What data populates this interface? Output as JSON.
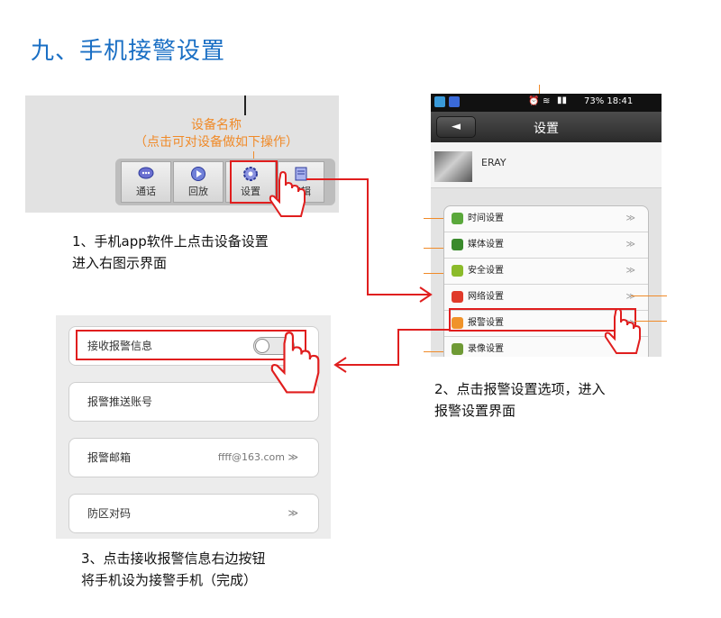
{
  "heading": "九、手机接警设置",
  "panel1": {
    "note_line1": "设备名称",
    "note_line2": "（点击可对设备做如下操作）",
    "toolbar": [
      "通话",
      "回放",
      "设置",
      "编辑"
    ],
    "caption_line1": "1、手机app软件上点击设备设置",
    "caption_line2": "进入右图示界面"
  },
  "panel2": {
    "status_right": "73% 18:41",
    "title": "设置",
    "back": "◄",
    "device_name": "ERAY",
    "items": [
      {
        "label": "时间设置",
        "color": "#5aa83b"
      },
      {
        "label": "媒体设置",
        "color": "#3a8a2c"
      },
      {
        "label": "安全设置",
        "color": "#8bbb2a"
      },
      {
        "label": "网络设置",
        "color": "#e03a2a"
      },
      {
        "label": "报警设置",
        "color": "#f0932a"
      },
      {
        "label": "录像设置",
        "color": "#6f9a35"
      }
    ],
    "chevron": "≫",
    "caption_line1": "2、点击报警设置选项，进入",
    "caption_line2": "报警设置界面"
  },
  "panel3": {
    "receive_label": "接收报警信息",
    "push_label": "报警推送账号",
    "email_label": "报警邮箱",
    "email_value": "ffff@163.com ≫",
    "zone_label": "防区对码",
    "zone_value": "≫",
    "caption_line1": "3、点击接收报警信息右边按钮",
    "caption_line2": "将手机设为接警手机（完成）"
  }
}
